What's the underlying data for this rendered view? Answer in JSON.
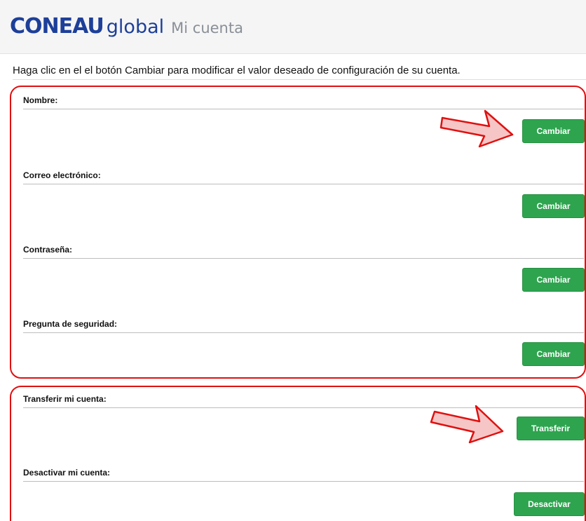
{
  "header": {
    "brand": "CONEAU",
    "brand_sub": "global",
    "page_title": "Mi cuenta"
  },
  "intro_text": "Haga clic en el el botón Cambiar para modificar el valor deseado de configuración de su cuenta.",
  "settings": [
    {
      "label": "Nombre:",
      "button": "Cambiar"
    },
    {
      "label": "Correo electrónico:",
      "button": "Cambiar"
    },
    {
      "label": "Contraseña:",
      "button": "Cambiar"
    },
    {
      "label": "Pregunta de seguridad:",
      "button": "Cambiar"
    }
  ],
  "account": [
    {
      "label": "Transferir mi cuenta:",
      "button": "Transferir"
    },
    {
      "label": "Desactivar mi cuenta:",
      "button": "Desactivar"
    }
  ],
  "colors": {
    "brand": "#1d3f99",
    "button": "#2ea44f",
    "highlight": "#e01010",
    "arrow_fill": "#f6c6c6"
  },
  "icons": [
    "right-arrow-icon"
  ]
}
